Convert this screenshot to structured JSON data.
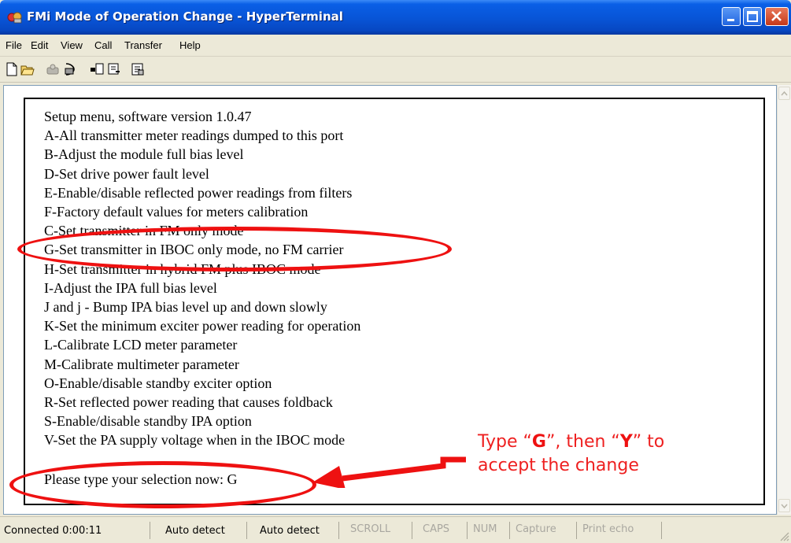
{
  "window": {
    "title": "FMi Mode of Operation Change - HyperTerminal",
    "buttons": [
      "minimize",
      "maximize",
      "close"
    ]
  },
  "menu": [
    "File",
    "Edit",
    "View",
    "Call",
    "Transfer",
    "Help"
  ],
  "toolbar": [
    "new-icon",
    "open-icon",
    "disconnect-icon",
    "dial-icon",
    "send-icon",
    "receive-icon",
    "properties-icon"
  ],
  "terminal": {
    "lines": [
      "Setup menu, software version 1.0.47",
      "A-All transmitter meter readings dumped to this port",
      "B-Adjust the module full bias level",
      "D-Set drive power fault level",
      "E-Enable/disable reflected power readings from filters",
      "F-Factory default values for meters calibration",
      "C-Set transmitter in FM only mode",
      "G-Set transmitter in IBOC only mode, no FM carrier",
      "H-Set transmitter in hybrid FM plus IBOC mode",
      "I-Adjust the IPA full bias level",
      "J and j - Bump IPA bias level up and down slowly",
      "K-Set the minimum exciter power reading for operation",
      "L-Calibrate LCD meter parameter",
      "M-Calibrate multimeter parameter",
      "O-Enable/disable standby exciter option",
      "R-Set reflected power reading that causes foldback",
      "S-Enable/disable standby IPA option",
      "V-Set the PA supply voltage when in the IBOC mode"
    ],
    "prompt": "Please type your selection now:  G"
  },
  "annotation": {
    "callout_pre": "Type “",
    "callout_key1": "G",
    "callout_mid": "”, then “",
    "callout_key2": "Y",
    "callout_post": "” to accept the change",
    "color": "#ee1111"
  },
  "statusbar": {
    "connected": "Connected 0:00:11",
    "detect1": "Auto detect",
    "detect2": "Auto detect",
    "scroll": "SCROLL",
    "caps": "CAPS",
    "num": "NUM",
    "capture": "Capture",
    "print_echo": "Print echo"
  }
}
